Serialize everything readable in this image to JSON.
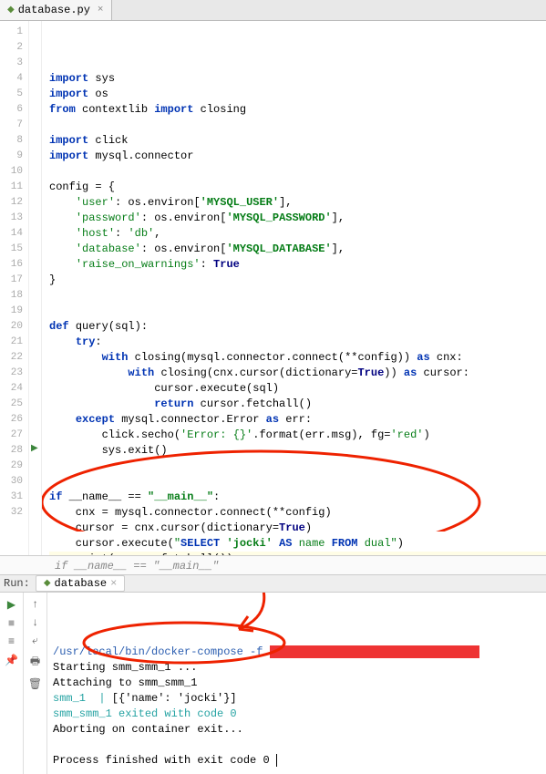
{
  "tab": {
    "filename": "database.py",
    "icon": "python-file-icon"
  },
  "code_lines": [
    {
      "n": 1,
      "c": "",
      "t": [
        {
          "s": "kw",
          "v": "import "
        },
        {
          "s": "mod",
          "v": "sys"
        }
      ]
    },
    {
      "n": 2,
      "c": "",
      "t": [
        {
          "s": "kw",
          "v": "import "
        },
        {
          "s": "mod",
          "v": "os"
        }
      ]
    },
    {
      "n": 3,
      "c": "",
      "t": [
        {
          "s": "kw",
          "v": "from "
        },
        {
          "s": "mod",
          "v": "contextlib "
        },
        {
          "s": "kw",
          "v": "import "
        },
        {
          "s": "mod",
          "v": "closing"
        }
      ]
    },
    {
      "n": 4,
      "c": "",
      "t": []
    },
    {
      "n": 5,
      "c": "",
      "t": [
        {
          "s": "kw",
          "v": "import "
        },
        {
          "s": "mod",
          "v": "click"
        }
      ]
    },
    {
      "n": 6,
      "c": "",
      "t": [
        {
          "s": "kw",
          "v": "import "
        },
        {
          "s": "mod",
          "v": "mysql.connector"
        }
      ]
    },
    {
      "n": 7,
      "c": "",
      "t": []
    },
    {
      "n": 8,
      "c": "",
      "t": [
        {
          "s": "mod",
          "v": "config = {"
        }
      ]
    },
    {
      "n": 9,
      "c": "",
      "t": [
        {
          "s": "mod",
          "v": "    "
        },
        {
          "s": "str",
          "v": "'user'"
        },
        {
          "s": "mod",
          "v": ": os.environ["
        },
        {
          "s": "strb",
          "v": "'MYSQL_USER'"
        },
        {
          "s": "mod",
          "v": "],"
        }
      ]
    },
    {
      "n": 10,
      "c": "",
      "t": [
        {
          "s": "mod",
          "v": "    "
        },
        {
          "s": "str",
          "v": "'password'"
        },
        {
          "s": "mod",
          "v": ": os.environ["
        },
        {
          "s": "strb",
          "v": "'MYSQL_PASSWORD'"
        },
        {
          "s": "mod",
          "v": "],"
        }
      ]
    },
    {
      "n": 11,
      "c": "",
      "t": [
        {
          "s": "mod",
          "v": "    "
        },
        {
          "s": "str",
          "v": "'host'"
        },
        {
          "s": "mod",
          "v": ": "
        },
        {
          "s": "str",
          "v": "'db'"
        },
        {
          "s": "mod",
          "v": ","
        }
      ]
    },
    {
      "n": 12,
      "c": "",
      "t": [
        {
          "s": "mod",
          "v": "    "
        },
        {
          "s": "str",
          "v": "'database'"
        },
        {
          "s": "mod",
          "v": ": os.environ["
        },
        {
          "s": "strb",
          "v": "'MYSQL_DATABASE'"
        },
        {
          "s": "mod",
          "v": "],"
        }
      ]
    },
    {
      "n": 13,
      "c": "",
      "t": [
        {
          "s": "mod",
          "v": "    "
        },
        {
          "s": "str",
          "v": "'raise_on_warnings'"
        },
        {
          "s": "mod",
          "v": ": "
        },
        {
          "s": "lit",
          "v": "True"
        }
      ]
    },
    {
      "n": 14,
      "c": "",
      "t": [
        {
          "s": "mod",
          "v": "}"
        }
      ]
    },
    {
      "n": 15,
      "c": "",
      "t": []
    },
    {
      "n": 16,
      "c": "",
      "t": []
    },
    {
      "n": 17,
      "c": "",
      "t": [
        {
          "s": "kw",
          "v": "def "
        },
        {
          "s": "fn",
          "v": "query"
        },
        {
          "s": "mod",
          "v": "(sql):"
        }
      ]
    },
    {
      "n": 18,
      "c": "",
      "t": [
        {
          "s": "mod",
          "v": "    "
        },
        {
          "s": "kw",
          "v": "try"
        },
        {
          "s": "mod",
          "v": ":"
        }
      ]
    },
    {
      "n": 19,
      "c": "",
      "t": [
        {
          "s": "mod",
          "v": "        "
        },
        {
          "s": "kw",
          "v": "with "
        },
        {
          "s": "mod",
          "v": "closing(mysql.connector.connect(**config)) "
        },
        {
          "s": "kw",
          "v": "as "
        },
        {
          "s": "mod",
          "v": "cnx:"
        }
      ]
    },
    {
      "n": 20,
      "c": "",
      "t": [
        {
          "s": "mod",
          "v": "            "
        },
        {
          "s": "kw",
          "v": "with "
        },
        {
          "s": "mod",
          "v": "closing(cnx.cursor("
        },
        {
          "s": "mod",
          "v": "dictionary"
        },
        {
          "s": "mod",
          "v": "="
        },
        {
          "s": "lit",
          "v": "True"
        },
        {
          "s": "mod",
          "v": ")) "
        },
        {
          "s": "kw",
          "v": "as "
        },
        {
          "s": "mod",
          "v": "cursor:"
        }
      ]
    },
    {
      "n": 21,
      "c": "",
      "t": [
        {
          "s": "mod",
          "v": "                cursor.execute(sql)"
        }
      ]
    },
    {
      "n": 22,
      "c": "",
      "t": [
        {
          "s": "mod",
          "v": "                "
        },
        {
          "s": "kw",
          "v": "return "
        },
        {
          "s": "mod",
          "v": "cursor.fetchall()"
        }
      ]
    },
    {
      "n": 23,
      "c": "",
      "t": [
        {
          "s": "mod",
          "v": "    "
        },
        {
          "s": "kw",
          "v": "except "
        },
        {
          "s": "mod",
          "v": "mysql.connector.Error "
        },
        {
          "s": "kw",
          "v": "as "
        },
        {
          "s": "mod",
          "v": "err:"
        }
      ]
    },
    {
      "n": 24,
      "c": "",
      "t": [
        {
          "s": "mod",
          "v": "        click.secho("
        },
        {
          "s": "str",
          "v": "'Error: {}'"
        },
        {
          "s": "mod",
          "v": ".format(err.msg), "
        },
        {
          "s": "mod",
          "v": "fg"
        },
        {
          "s": "mod",
          "v": "="
        },
        {
          "s": "str",
          "v": "'red'"
        },
        {
          "s": "mod",
          "v": ")"
        }
      ]
    },
    {
      "n": 25,
      "c": "",
      "t": [
        {
          "s": "mod",
          "v": "        sys.exit()"
        }
      ]
    },
    {
      "n": 26,
      "c": "",
      "t": []
    },
    {
      "n": 27,
      "c": "",
      "t": []
    },
    {
      "n": 28,
      "c": "",
      "t": [
        {
          "s": "kw",
          "v": "if "
        },
        {
          "s": "mod",
          "v": "__name__ == "
        },
        {
          "s": "strb",
          "v": "\"__main__\""
        },
        {
          "s": "mod",
          "v": ":"
        }
      ],
      "marker": "play"
    },
    {
      "n": 29,
      "c": "",
      "t": [
        {
          "s": "mod",
          "v": "    cnx = mysql.connector.connect(**config)"
        }
      ]
    },
    {
      "n": 30,
      "c": "",
      "t": [
        {
          "s": "mod",
          "v": "    cursor = cnx.cursor("
        },
        {
          "s": "mod",
          "v": "dictionary"
        },
        {
          "s": "mod",
          "v": "="
        },
        {
          "s": "lit",
          "v": "True"
        },
        {
          "s": "mod",
          "v": ")"
        }
      ]
    },
    {
      "n": 31,
      "c": "",
      "t": [
        {
          "s": "mod",
          "v": "    cursor.execute("
        },
        {
          "s": "str",
          "v": "\""
        },
        {
          "s": "sqlkw",
          "v": "SELECT "
        },
        {
          "s": "strb",
          "v": "'jocki'"
        },
        {
          "s": "sqlkw",
          "v": " AS "
        },
        {
          "s": "str",
          "v": "name "
        },
        {
          "s": "sqlkw",
          "v": "FROM "
        },
        {
          "s": "str",
          "v": "dual"
        },
        {
          "s": "str",
          "v": "\""
        },
        {
          "s": "mod",
          "v": ")"
        }
      ]
    },
    {
      "n": 32,
      "c": "hl-line",
      "t": [
        {
          "s": "mod",
          "v": "    print(cursor.fetchall())"
        }
      ]
    }
  ],
  "breadcrumb": "if __name__ == \"__main__\"",
  "run": {
    "label": "Run:",
    "tab": "database",
    "output": [
      {
        "cls": "out-blue",
        "text": "/usr/local/bin/docker-compose -f ",
        "redbar": true
      },
      {
        "cls": "out-black",
        "text": "Starting smm_smm_1 ..."
      },
      {
        "cls": "out-black",
        "text": "Attaching to smm_smm_1"
      },
      {
        "cls": "mix",
        "parts": [
          {
            "cls": "out-cyan",
            "text": "smm_1  |"
          },
          {
            "cls": "out-black",
            "text": " [{'name': 'jocki'}]"
          }
        ]
      },
      {
        "cls": "out-cyan",
        "text": "smm_smm_1 exited with code 0"
      },
      {
        "cls": "out-black",
        "text": "Aborting on container exit..."
      },
      {
        "cls": "out-black",
        "text": ""
      },
      {
        "cls": "out-black",
        "text": "Process finished with exit code 0"
      }
    ]
  },
  "toolbar_left": [
    "play",
    "stop",
    "bars",
    "pin"
  ],
  "toolbar_left2": [
    "up",
    "down",
    "wrap",
    "print",
    "trash"
  ]
}
